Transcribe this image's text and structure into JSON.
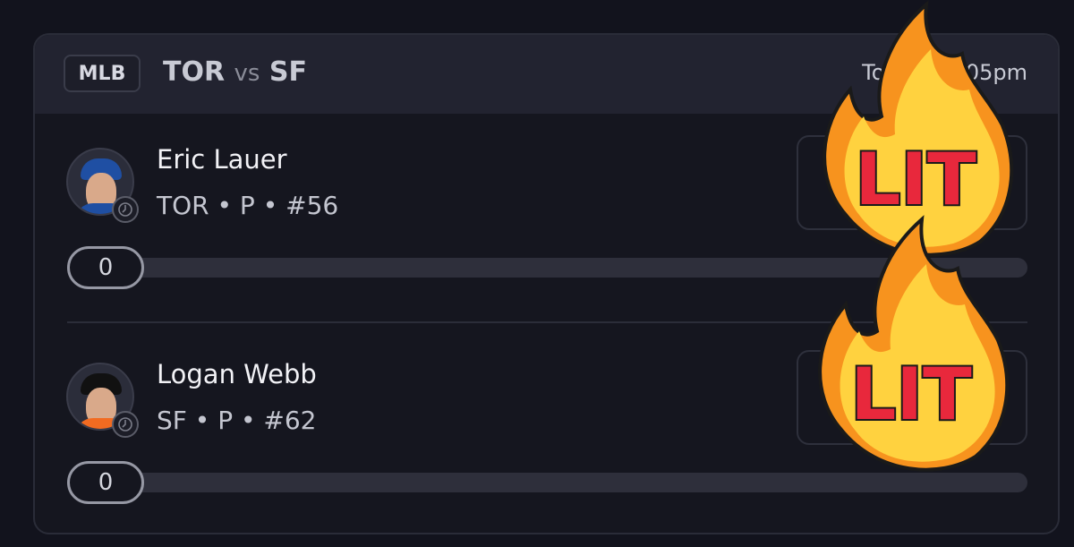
{
  "game": {
    "league": "MLB",
    "away_team": "TOR",
    "vs": "vs",
    "home_team": "SF",
    "time": "Today 12:05pm"
  },
  "players": [
    {
      "name": "Eric Lauer",
      "meta": "TOR • P • #56",
      "count": "0",
      "progress": 0,
      "cap_color": "#1f4fa3",
      "shirt_color": "#1f4fa3"
    },
    {
      "name": "Logan Webb",
      "meta": "SF • P • #62",
      "count": "0",
      "progress": 0,
      "cap_color": "#111111",
      "shirt_color": "#f26b21"
    }
  ],
  "stickers": [
    {
      "text": "LIT"
    },
    {
      "text": "LIT"
    }
  ],
  "colors": {
    "background": "#12131d",
    "card_header": "#222330",
    "flame_outer": "#f7931e",
    "flame_inner": "#ffd23f",
    "lit_text": "#e8283c"
  }
}
